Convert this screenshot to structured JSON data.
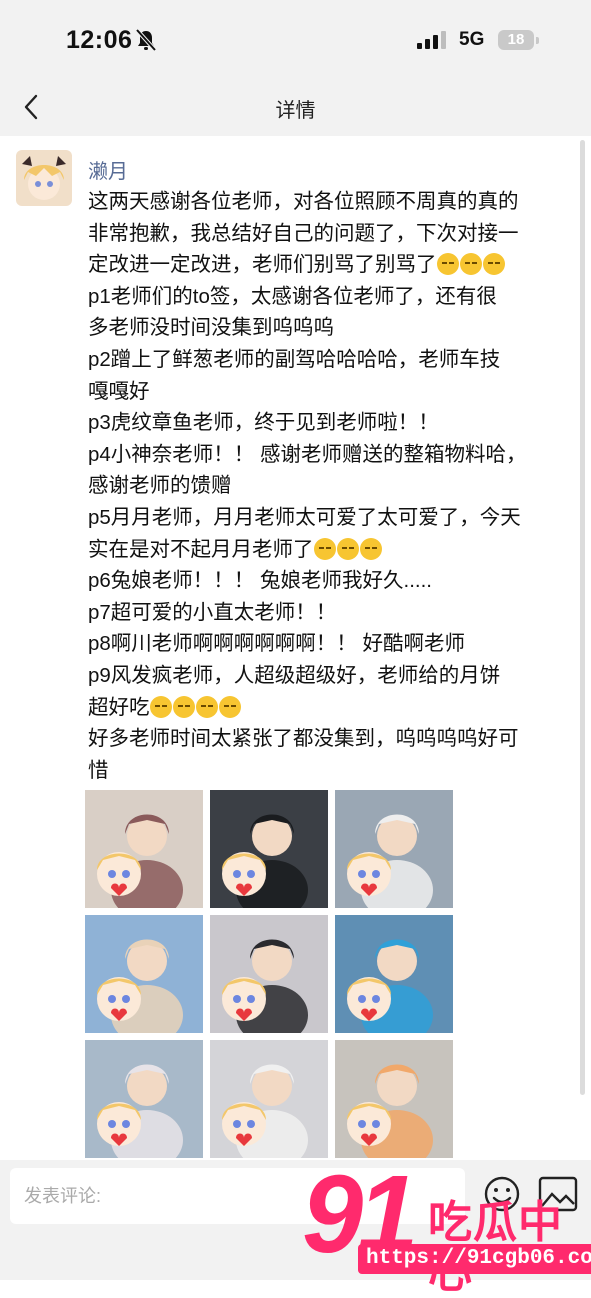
{
  "status": {
    "time": "12:06",
    "network": "5G",
    "battery": "18"
  },
  "nav": {
    "title": "详情"
  },
  "post": {
    "author": "濑月",
    "lines": [
      {
        "t": "这两天感谢各位老师，对各位照顾不周真的真的",
        "e": 0
      },
      {
        "t": "非常抱歉，我总结好自己的问题了，下次对接一",
        "e": 0
      },
      {
        "t": "定改进一定改进，老师们别骂了别骂了",
        "e": 3
      },
      {
        "t": "p1老师们的to签，太感谢各位老师了，还有很",
        "e": 0
      },
      {
        "t": "多老师没时间没集到呜呜呜",
        "e": 0
      },
      {
        "t": "p2蹭上了鲜葱老师的副驾哈哈哈哈，老师车技",
        "e": 0
      },
      {
        "t": "嘎嘎好",
        "e": 0
      },
      {
        "t": "p3虎纹章鱼老师，终于见到老师啦！！",
        "e": 0
      },
      {
        "t": "p4小神奈老师！！ 感谢老师赠送的整箱物料哈，",
        "e": 0
      },
      {
        "t": "感谢老师的馈赠",
        "e": 0
      },
      {
        "t": "p5月月老师，月月老师太可爱了太可爱了，今天",
        "e": 0
      },
      {
        "t": "实在是对不起月月老师了",
        "e": 3
      },
      {
        "t": "p6兔娘老师！！！ 兔娘老师我好久.....",
        "e": 0
      },
      {
        "t": "p7超可爱的小直太老师！！",
        "e": 0
      },
      {
        "t": "p8啊川老师啊啊啊啊啊啊！！ 好酷啊老师",
        "e": 0
      },
      {
        "t": "p9风发疯老师，人超级超级好，老师给的月饼",
        "e": 0
      },
      {
        "t": "超好吃",
        "e": 4
      },
      {
        "t": "好多老师时间太紧张了都没集到，呜呜呜呜好可",
        "e": 0
      },
      {
        "t": "惜",
        "e": 0
      }
    ],
    "photos": [
      {
        "bg": "#d9cfc6",
        "fg": "#8a5a5a"
      },
      {
        "bg": "#3b3f45",
        "fg": "#1a1c1f"
      },
      {
        "bg": "#9aa7b4",
        "fg": "#eeeeee"
      },
      {
        "bg": "#8fb2d6",
        "fg": "#e9d2b8"
      },
      {
        "bg": "#c9c7cc",
        "fg": "#2a2a2e"
      },
      {
        "bg": "#5f8fb4",
        "fg": "#2fa0d8"
      },
      {
        "bg": "#a8b9c9",
        "fg": "#e7e3e8"
      },
      {
        "bg": "#d4d4d8",
        "fg": "#f0f0f0"
      },
      {
        "bg": "#c7c3bd",
        "fg": "#f1a86a"
      }
    ]
  },
  "comment": {
    "placeholder": "发表评论:"
  },
  "watermark": {
    "number": "91",
    "name": "吃瓜中心",
    "url": "https://91cgb06.com"
  },
  "colors": {
    "username": "#576b95",
    "watermark": "#ff2a6d"
  }
}
